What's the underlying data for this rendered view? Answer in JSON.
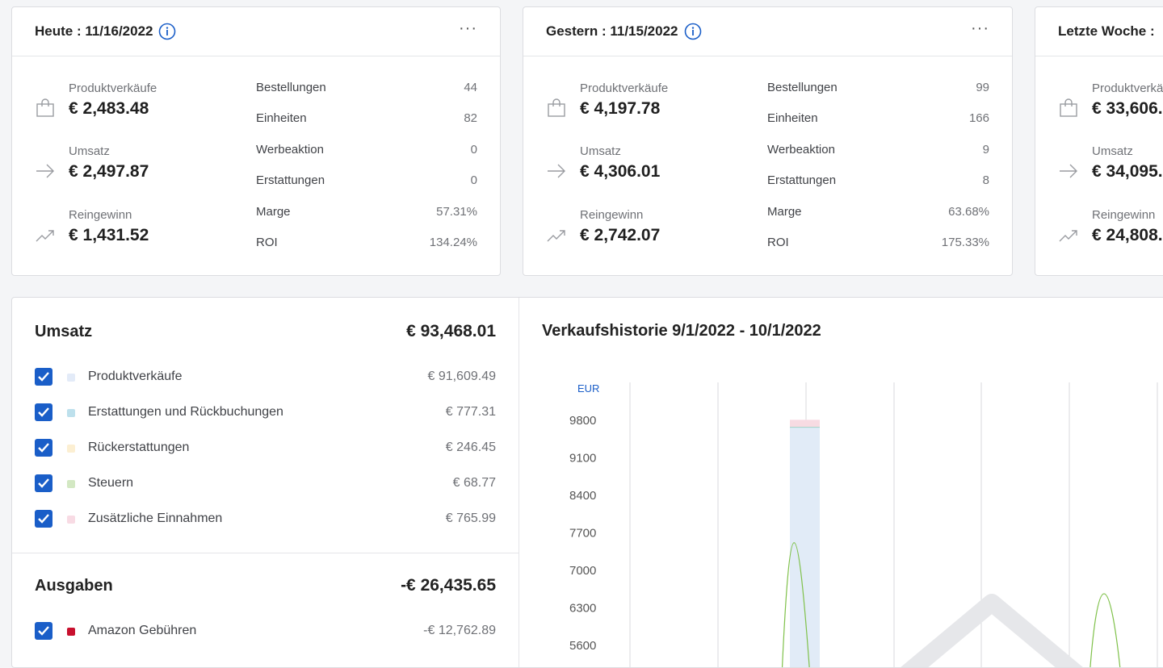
{
  "colors": {
    "accent": "#1a5ec8",
    "checkbox": "#1a5ec8",
    "grid": "#d9dade",
    "bar_main": "#e1ebf7",
    "bar_top": "#f7dbe2",
    "line": "#7fc14a"
  },
  "cards": [
    {
      "title": "Heute : 11/16/2022",
      "metrics": [
        {
          "label": "Produktverkäufe",
          "value": "€ 2,483.48",
          "icon": "shopping-bag-icon"
        },
        {
          "label": "Umsatz",
          "value": "€ 2,497.87",
          "icon": "arrow-right-icon"
        },
        {
          "label": "Reingewinn",
          "value": "€ 1,431.52",
          "icon": "trending-up-icon"
        }
      ],
      "stats": [
        {
          "label": "Bestellungen",
          "value": "44"
        },
        {
          "label": "Einheiten",
          "value": "82"
        },
        {
          "label": "Werbeaktion",
          "value": "0"
        },
        {
          "label": "Erstattungen",
          "value": "0"
        },
        {
          "label": "Marge",
          "value": "57.31%"
        },
        {
          "label": "ROI",
          "value": "134.24%"
        }
      ]
    },
    {
      "title": "Gestern : 11/15/2022",
      "metrics": [
        {
          "label": "Produktverkäufe",
          "value": "€ 4,197.78",
          "icon": "shopping-bag-icon"
        },
        {
          "label": "Umsatz",
          "value": "€ 4,306.01",
          "icon": "arrow-right-icon"
        },
        {
          "label": "Reingewinn",
          "value": "€ 2,742.07",
          "icon": "trending-up-icon"
        }
      ],
      "stats": [
        {
          "label": "Bestellungen",
          "value": "99"
        },
        {
          "label": "Einheiten",
          "value": "166"
        },
        {
          "label": "Werbeaktion",
          "value": "9"
        },
        {
          "label": "Erstattungen",
          "value": "8"
        },
        {
          "label": "Marge",
          "value": "63.68%"
        },
        {
          "label": "ROI",
          "value": "175.33%"
        }
      ]
    },
    {
      "title": "Letzte Woche :",
      "metrics": [
        {
          "label": "Produktverkä",
          "value": "€ 33,606.",
          "icon": "shopping-bag-icon"
        },
        {
          "label": "Umsatz",
          "value": "€ 34,095.",
          "icon": "arrow-right-icon"
        },
        {
          "label": "Reingewinn",
          "value": "€ 24,808.",
          "icon": "trending-up-icon"
        }
      ]
    }
  ],
  "revenue": {
    "title": "Umsatz",
    "total": "€ 93,468.01",
    "items": [
      {
        "label": "Produktverkäufe",
        "value": "€ 91,609.49",
        "color": "#e3ebf8"
      },
      {
        "label": "Erstattungen und Rückbuchungen",
        "value": "€ 777.31",
        "color": "#bde0ec"
      },
      {
        "label": "Rückerstattungen",
        "value": "€ 246.45",
        "color": "#fcefd2"
      },
      {
        "label": "Steuern",
        "value": "€ 68.77",
        "color": "#d3e8c3"
      },
      {
        "label": "Zusätzliche Einnahmen",
        "value": "€ 765.99",
        "color": "#f8dbe4"
      }
    ]
  },
  "expenses": {
    "title": "Ausgaben",
    "total": "-€ 26,435.65",
    "items": [
      {
        "label": "Amazon Gebühren",
        "value": "-€ 12,762.89",
        "color": "#c8102e"
      }
    ]
  },
  "chart_title": "Verkaufshistorie 9/1/2022 - 10/1/2022",
  "chart_data": {
    "type": "bar",
    "ylabel": "EUR",
    "y_ticks": [
      9800,
      9100,
      8400,
      7700,
      7000,
      6300,
      5600
    ],
    "ylim": [
      5600,
      9800
    ],
    "grid": true,
    "series": [
      {
        "type": "bar",
        "values": [
          9670
        ]
      },
      {
        "type": "bar",
        "values": [
          140
        ]
      },
      {
        "type": "line",
        "values": [
          8050,
          6780
        ]
      }
    ]
  }
}
